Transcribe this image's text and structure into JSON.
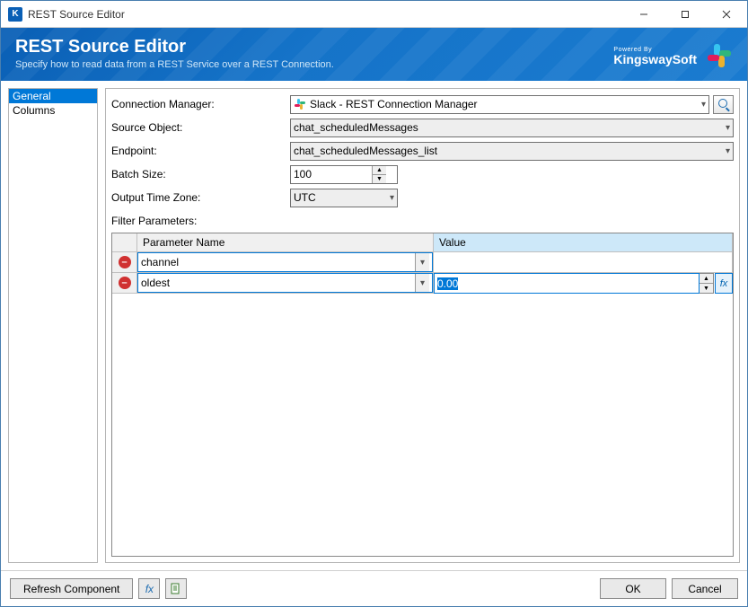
{
  "titlebar": {
    "title": "REST Source Editor"
  },
  "header": {
    "heading": "REST Source Editor",
    "subtitle": "Specify how to read data from a REST Service over a REST Connection.",
    "powered_by": "Powered By",
    "brand": "KingswaySoft"
  },
  "sidebar": {
    "tabs": [
      {
        "label": "General",
        "active": true
      },
      {
        "label": "Columns",
        "active": false
      }
    ]
  },
  "form": {
    "connection_manager_label": "Connection Manager:",
    "connection_manager_value": "Slack - REST Connection Manager",
    "source_object_label": "Source Object:",
    "source_object_value": "chat_scheduledMessages",
    "endpoint_label": "Endpoint:",
    "endpoint_value": "chat_scheduledMessages_list",
    "batch_size_label": "Batch Size:",
    "batch_size_value": "100",
    "output_tz_label": "Output Time Zone:",
    "output_tz_value": "UTC",
    "filter_params_label": "Filter Parameters:"
  },
  "grid": {
    "header_name": "Parameter Name",
    "header_value": "Value",
    "rows": [
      {
        "name": "channel",
        "value": ""
      },
      {
        "name": "oldest",
        "value": "0.00",
        "editing": true
      }
    ]
  },
  "footer": {
    "refresh": "Refresh Component",
    "ok": "OK",
    "cancel": "Cancel"
  },
  "icons": {
    "fx": "fx"
  }
}
